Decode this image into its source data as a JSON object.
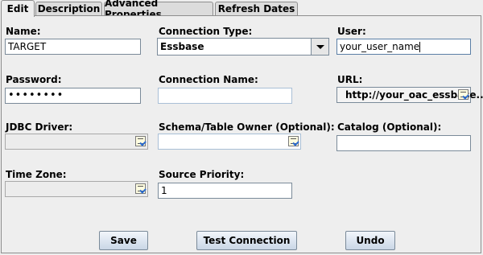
{
  "tabs": {
    "edit": "Edit",
    "description": "Description",
    "advanced": "Advanced Properties",
    "refresh": "Refresh Dates"
  },
  "form": {
    "name": {
      "label": "Name:",
      "value": "TARGET"
    },
    "connection_type": {
      "label": "Connection Type:",
      "value": "Essbase"
    },
    "user": {
      "label": "User:",
      "value": "your_user_name"
    },
    "password": {
      "label": "Password:",
      "value": "••••••••"
    },
    "connection_name": {
      "label": "Connection Name:",
      "value": ""
    },
    "url": {
      "label": "URL:",
      "value": "http://your_oac_essbase..."
    },
    "jdbc_driver": {
      "label": "JDBC Driver:",
      "value": ""
    },
    "schema_owner": {
      "label": "Schema/Table Owner (Optional):",
      "value": ""
    },
    "catalog": {
      "label": "Catalog (Optional):",
      "value": ""
    },
    "time_zone": {
      "label": "Time Zone:",
      "value": ""
    },
    "source_priority": {
      "label": "Source Priority:",
      "value": "1"
    }
  },
  "buttons": {
    "save": "Save",
    "test": "Test Connection",
    "undo": "Undo"
  }
}
